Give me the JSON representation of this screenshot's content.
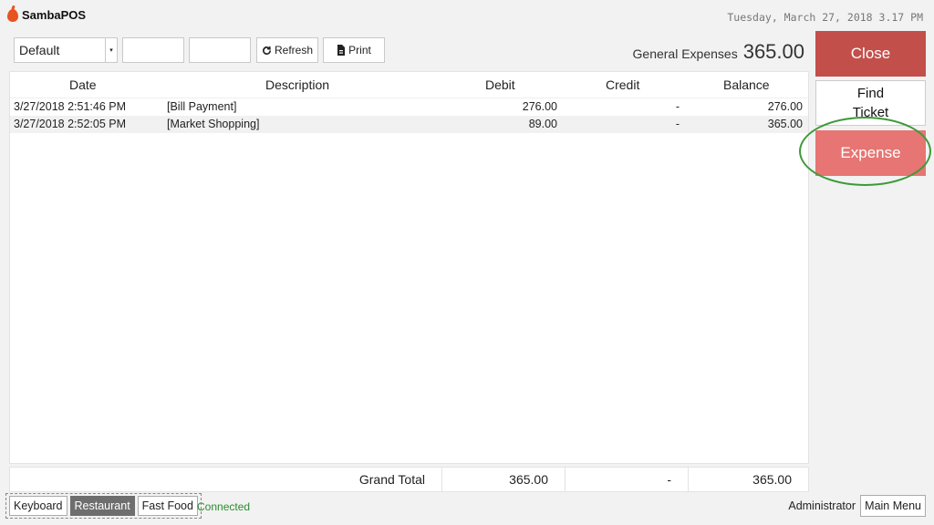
{
  "header": {
    "app_name": "SambaPOS",
    "datetime": "Tuesday, March 27, 2018 3.17 PM"
  },
  "toolbar": {
    "account_template": "Default",
    "start_date": "",
    "end_date": "",
    "refresh_label": "Refresh",
    "print_label": "Print"
  },
  "account": {
    "name": "General Expenses",
    "balance": "365.00"
  },
  "table": {
    "columns": [
      "Date",
      "Description",
      "Debit",
      "Credit",
      "Balance"
    ],
    "rows": [
      {
        "date": "3/27/2018 2:51:46 PM",
        "description": "[Bill Payment]",
        "debit": "276.00",
        "credit": "-",
        "balance": "276.00"
      },
      {
        "date": "3/27/2018 2:52:05 PM",
        "description": "[Market Shopping]",
        "debit": "89.00",
        "credit": "-",
        "balance": "365.00"
      }
    ],
    "totals": {
      "label": "Grand Total",
      "debit": "365.00",
      "credit": "-",
      "balance": "365.00"
    }
  },
  "side_buttons": {
    "close": "Close",
    "find_ticket_line1": "Find",
    "find_ticket_line2": "Ticket",
    "expense": "Expense"
  },
  "footer": {
    "keyboard": "Keyboard",
    "restaurant": "Restaurant",
    "fast_food": "Fast Food",
    "status": "Connected",
    "user": "Administrator",
    "main_menu": "Main Menu"
  },
  "colors": {
    "close_button": "#c34f4b",
    "expense_button": "#e67573",
    "highlight_ring": "#3c9a37",
    "status_connected": "#2e8b2e"
  },
  "icons": {
    "refresh": "refresh-icon",
    "print": "print-icon",
    "logo": "sambapos-logo-icon"
  }
}
